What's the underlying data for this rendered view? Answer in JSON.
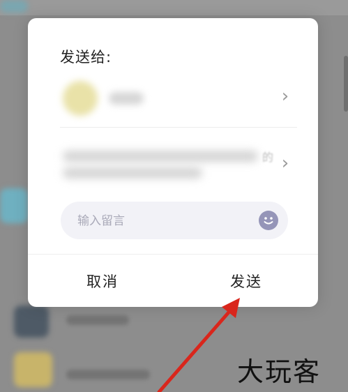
{
  "dialog": {
    "title": "发送给:",
    "message_placeholder": "输入留言",
    "cancel_label": "取消",
    "send_label": "发送",
    "recipients": [
      {
        "chevron": "›"
      },
      {
        "chevron": "›",
        "trailing_char": "的"
      }
    ]
  },
  "watermark": {
    "text": "大玩客"
  },
  "colors": {
    "annotation_arrow": "#d9261c",
    "emoji_button": "#9595b8",
    "input_background": "#f2f2f7"
  }
}
